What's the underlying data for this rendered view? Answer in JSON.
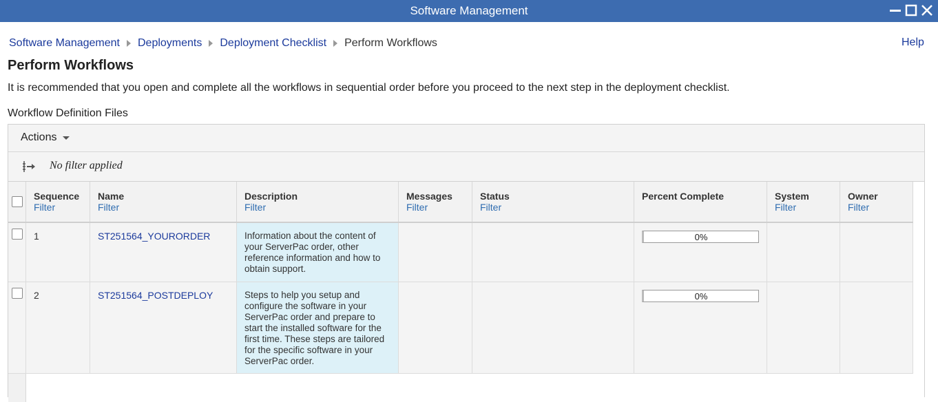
{
  "window": {
    "title": "Software Management"
  },
  "breadcrumb": {
    "items": [
      "Software Management",
      "Deployments",
      "Deployment Checklist"
    ],
    "current": "Perform Workflows"
  },
  "help_label": "Help",
  "page": {
    "title": "Perform Workflows",
    "intro": "It is recommended that you open and complete all the workflows in sequential order before you proceed to the next step in the deployment checklist.",
    "section_label": "Workflow Definition Files"
  },
  "toolbar": {
    "actions_label": "Actions",
    "filter_status": "No filter applied"
  },
  "table": {
    "filter_label": "Filter",
    "columns": [
      "Sequence",
      "Name",
      "Description",
      "Messages",
      "Status",
      "Percent Complete",
      "System",
      "Owner"
    ],
    "rows": [
      {
        "sequence": "1",
        "name": "ST251564_YOURORDER",
        "description": "Information about the content of your ServerPac order, other reference information and how to obtain support.",
        "messages": "",
        "status": "",
        "percent_complete": "0%",
        "percent_value": 0,
        "system": "",
        "owner": ""
      },
      {
        "sequence": "2",
        "name": "ST251564_POSTDEPLOY",
        "description": "Steps to help you setup and configure the software in your ServerPac order and prepare to start the installed software for the first time. These steps are tailored for the specific software in your ServerPac order.",
        "messages": "",
        "status": "",
        "percent_complete": "0%",
        "percent_value": 0,
        "system": "",
        "owner": ""
      }
    ]
  },
  "colors": {
    "titlebar": "#3d6cb0",
    "link": "#1b3a9c",
    "filter_link": "#2e6cb0",
    "description_bg": "#ddf1f8"
  },
  "icons": [
    "minimize-icon",
    "maximize-icon",
    "close-icon",
    "filter-icon",
    "caret-down-icon",
    "breadcrumb-separator-icon"
  ]
}
